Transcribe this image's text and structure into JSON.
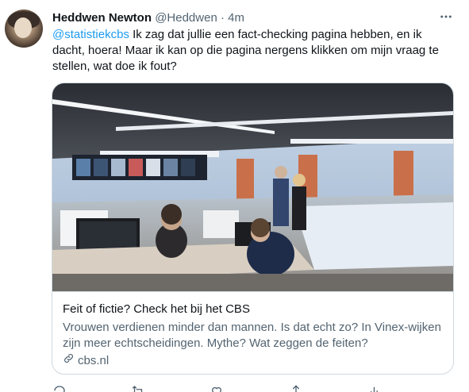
{
  "tweet": {
    "author_name": "Heddwen Newton",
    "author_handle": "@Heddwen",
    "separator": "·",
    "time": "4m",
    "mention": "@statistiekcbs",
    "text": " Ik zag dat jullie een fact-checking pagina hebben, en ik dacht, hoera! Maar ik kan op die pagina nergens klikken om mijn vraag te stellen, wat doe ik fout?"
  },
  "card": {
    "title": "Feit of fictie? Check het bij het CBS",
    "description": "Vrouwen verdienen minder dan mannen. Is dat echt zo? In Vinex-wijken zijn meer echtscheidingen. Mythe? Wat zeggen de feiten?",
    "domain": "cbs.nl"
  },
  "icons": {
    "more": "more-icon",
    "link": "link-icon",
    "reply": "reply-icon",
    "retweet": "retweet-icon",
    "like": "like-icon",
    "share": "share-icon"
  },
  "colors": {
    "link": "#1d9bf0",
    "secondary_text": "#536471",
    "border": "#cfd9de"
  }
}
